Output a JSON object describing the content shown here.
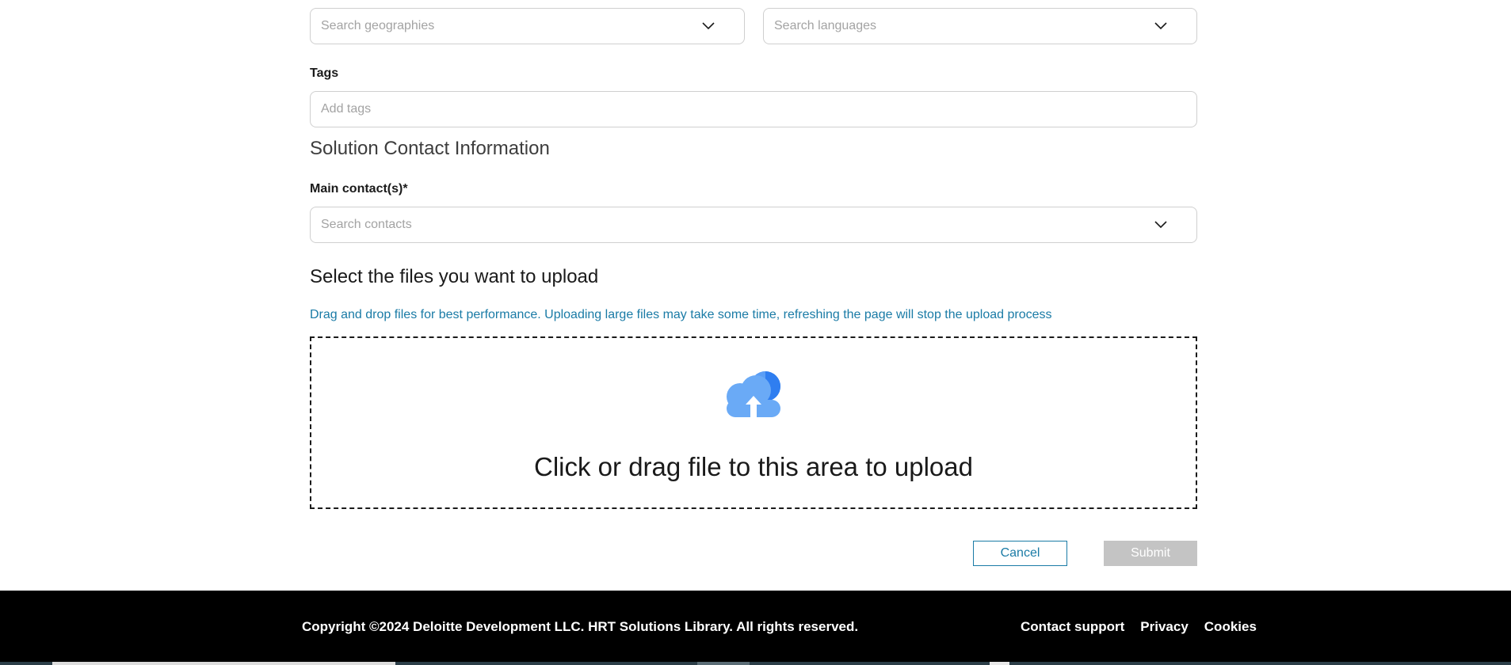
{
  "filters": {
    "geographies_placeholder": "Search geographies",
    "languages_placeholder": "Search languages"
  },
  "tags": {
    "label": "Tags",
    "placeholder": "Add tags"
  },
  "contact_section": {
    "title": "Solution Contact Information",
    "main_contact_label": "Main contact(s)*",
    "contacts_placeholder": "Search contacts"
  },
  "upload": {
    "title": "Select the files you want to upload",
    "hint": "Drag and drop files for best performance. Uploading large files may take some time, refreshing the page will stop the upload process",
    "drop_text": "Click or drag file to this area to upload",
    "icon": "cloud-upload-icon"
  },
  "actions": {
    "cancel_label": "Cancel",
    "submit_label": "Submit"
  },
  "footer": {
    "copyright": "Copyright ©2024 Deloitte Development LLC. HRT Solutions Library. All rights reserved.",
    "links": [
      "Contact support",
      "Privacy",
      "Cookies"
    ]
  },
  "colors": {
    "accent": "#1a7ba6",
    "submit_disabled": "#c4c4c4",
    "footer_bg": "#000000"
  }
}
